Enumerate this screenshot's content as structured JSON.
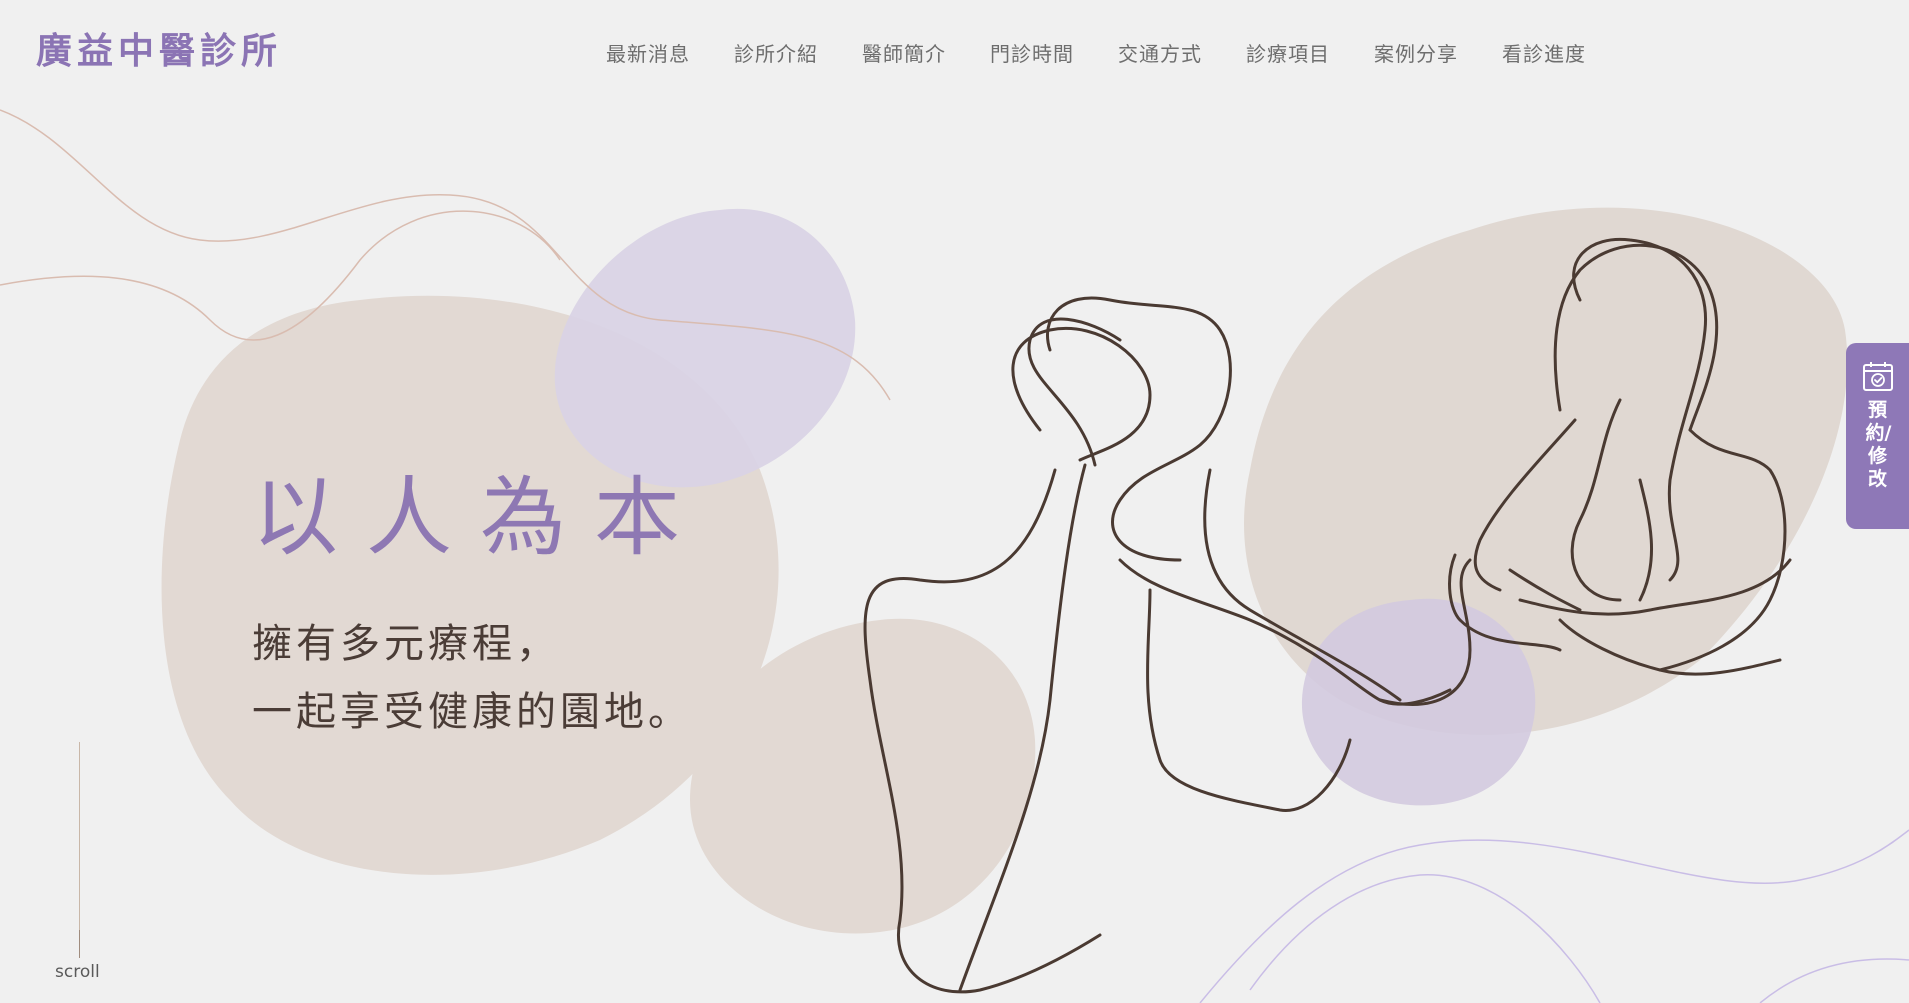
{
  "header": {
    "logo_text": "廣益中醫診所",
    "nav": [
      {
        "label": "最新消息"
      },
      {
        "label": "診所介紹"
      },
      {
        "label": "醫師簡介"
      },
      {
        "label": "門診時間"
      },
      {
        "label": "交通方式"
      },
      {
        "label": "診療項目"
      },
      {
        "label": "案例分享"
      },
      {
        "label": "看診進度"
      }
    ]
  },
  "hero": {
    "title": "以人為本",
    "subtitle_line1": "擁有多元療程，",
    "subtitle_line2": "一起享受健康的園地。"
  },
  "scroll": {
    "label": "scroll"
  },
  "booking": {
    "label": "預約/修改",
    "icon": "calendar-check-icon"
  },
  "colors": {
    "brand_purple": "#8b74b4",
    "background": "#f0f0f0",
    "blob_beige": "#e2d9d3",
    "blob_lavender": "#dcd6e6",
    "line_art": "#4a3a32"
  }
}
